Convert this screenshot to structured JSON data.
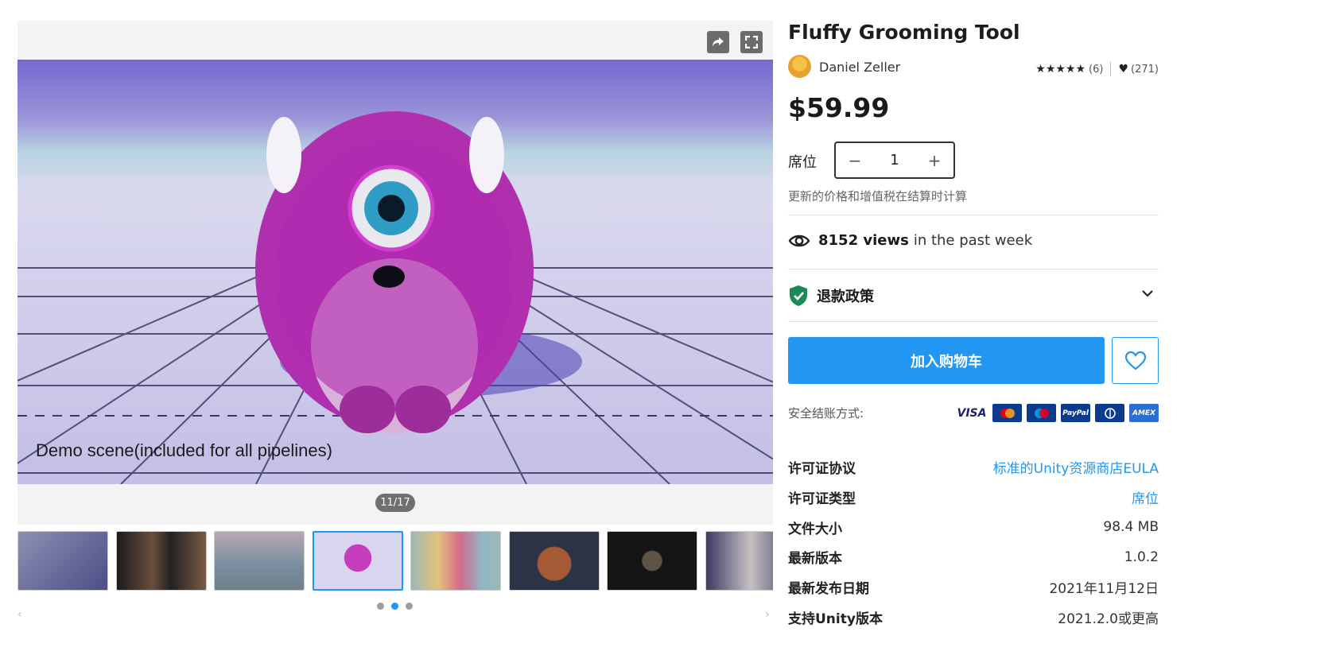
{
  "gallery": {
    "caption": "Demo scene(included for all pipelines)",
    "counter": "11/17",
    "share_icon": "share-icon",
    "fullscreen_icon": "fullscreen-icon",
    "thumbnails": [
      "wolves",
      "faces",
      "fur-platform",
      "pink-monster",
      "creatures",
      "bear",
      "soldier",
      "raccoon"
    ],
    "active_thumbnail": 3,
    "pager_dots": 3,
    "active_dot": 1
  },
  "product": {
    "title": "Fluffy Grooming Tool",
    "author": "Daniel Zeller",
    "stars": "★★★★★",
    "rating_count": "(6)",
    "favorites_count": "(271)",
    "price": "$59.99",
    "seat_label": "席位",
    "quantity": "1",
    "minus": "−",
    "plus": "+",
    "vat_note": "更新的价格和增值税在结算时计算",
    "views_count": "8152 views",
    "views_suffix": "in the past week",
    "refund_label": "退款政策",
    "add_to_cart": "加入购物车",
    "payment_label": "安全结账方式:",
    "payment_methods": [
      "VISA",
      "MC",
      "Maestro",
      "PayPal",
      "Diners",
      "AMEX"
    ],
    "accent_color": "#2196f3"
  },
  "specs": [
    {
      "key": "许可证协议",
      "value": "标准的Unity资源商店EULA",
      "link": true
    },
    {
      "key": "许可证类型",
      "value": "席位",
      "link": true
    },
    {
      "key": "文件大小",
      "value": "98.4 MB",
      "link": false
    },
    {
      "key": "最新版本",
      "value": "1.0.2",
      "link": false
    },
    {
      "key": "最新发布日期",
      "value": "2021年11月12日",
      "link": false
    },
    {
      "key": "支持Unity版本",
      "value": "2021.2.0或更高",
      "link": false
    }
  ]
}
